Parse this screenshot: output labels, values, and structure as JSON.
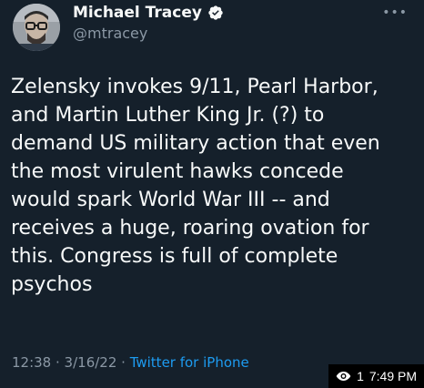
{
  "author": {
    "display_name": "Michael Tracey",
    "handle": "@mtracey",
    "verified_icon": "verified-badge-icon"
  },
  "more_icon": "more-icon",
  "tweet": {
    "text": "Zelensky invokes 9/11, Pearl Harbor,\nand Martin Luther King Jr. (?) to\ndemand US military action that even\nthe most virulent hawks concede\nwould spark World War III -- and\nreceives a huge, roaring ovation for\nthis. Congress is full of complete\npsychos",
    "time": "12:38",
    "separator": " · ",
    "date": "3/16/22",
    "client": "Twitter for iPhone"
  },
  "overlay": {
    "view_count": "1",
    "clock": "7:49 PM"
  },
  "colors": {
    "background": "#15202b",
    "accent": "#1d9bf0",
    "secondary_text": "#8b98a5"
  }
}
